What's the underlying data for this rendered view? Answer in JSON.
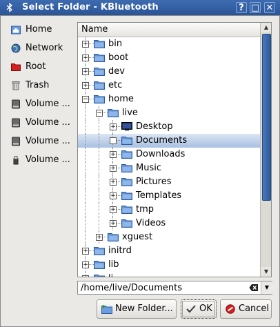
{
  "window": {
    "title": "Select Folder - KBluetooth",
    "help_glyph": "?",
    "max_glyph": "□",
    "close_glyph": "✕"
  },
  "places": [
    {
      "label": "Home",
      "icon": "home-folder-icon"
    },
    {
      "label": "Network",
      "icon": "network-globe-icon"
    },
    {
      "label": "Root",
      "icon": "red-folder-icon"
    },
    {
      "label": "Trash",
      "icon": "trash-icon"
    },
    {
      "label": "Volume ...",
      "icon": "drive-icon"
    },
    {
      "label": "Volume ...",
      "icon": "drive-icon"
    },
    {
      "label": "Volume ...",
      "icon": "drive-icon"
    },
    {
      "label": "Volume ...",
      "icon": "usb-drive-icon"
    }
  ],
  "tree": {
    "column_header": "Name",
    "rows": [
      {
        "label": "bin",
        "depth": 0,
        "expander": "+"
      },
      {
        "label": "boot",
        "depth": 0,
        "expander": "+"
      },
      {
        "label": "dev",
        "depth": 0,
        "expander": "+"
      },
      {
        "label": "etc",
        "depth": 0,
        "expander": "+"
      },
      {
        "label": "home",
        "depth": 0,
        "expander": "−"
      },
      {
        "label": "live",
        "depth": 1,
        "expander": "−"
      },
      {
        "label": "Desktop",
        "depth": 2,
        "expander": "+",
        "icon": "desktop-icon"
      },
      {
        "label": "Documents",
        "depth": 2,
        "expander": "",
        "selected": true
      },
      {
        "label": "Downloads",
        "depth": 2,
        "expander": "+"
      },
      {
        "label": "Music",
        "depth": 2,
        "expander": "+"
      },
      {
        "label": "Pictures",
        "depth": 2,
        "expander": "+"
      },
      {
        "label": "Templates",
        "depth": 2,
        "expander": "+"
      },
      {
        "label": "tmp",
        "depth": 2,
        "expander": "+"
      },
      {
        "label": "Videos",
        "depth": 2,
        "expander": "+"
      },
      {
        "label": "xguest",
        "depth": 1,
        "expander": "+"
      },
      {
        "label": "initrd",
        "depth": 0,
        "expander": "+"
      },
      {
        "label": "lib",
        "depth": 0,
        "expander": "+"
      },
      {
        "label": "li",
        "depth": 0,
        "expander": "+"
      }
    ]
  },
  "path": {
    "value": "/home/live/Documents"
  },
  "buttons": {
    "new_folder": "New Folder...",
    "ok": "OK",
    "cancel": "Cancel"
  },
  "colors": {
    "titlebar": "#2f5c9f",
    "selection": "#a8c0e2",
    "folder": "#5b8fd6",
    "accent": "#2d5a9b"
  }
}
